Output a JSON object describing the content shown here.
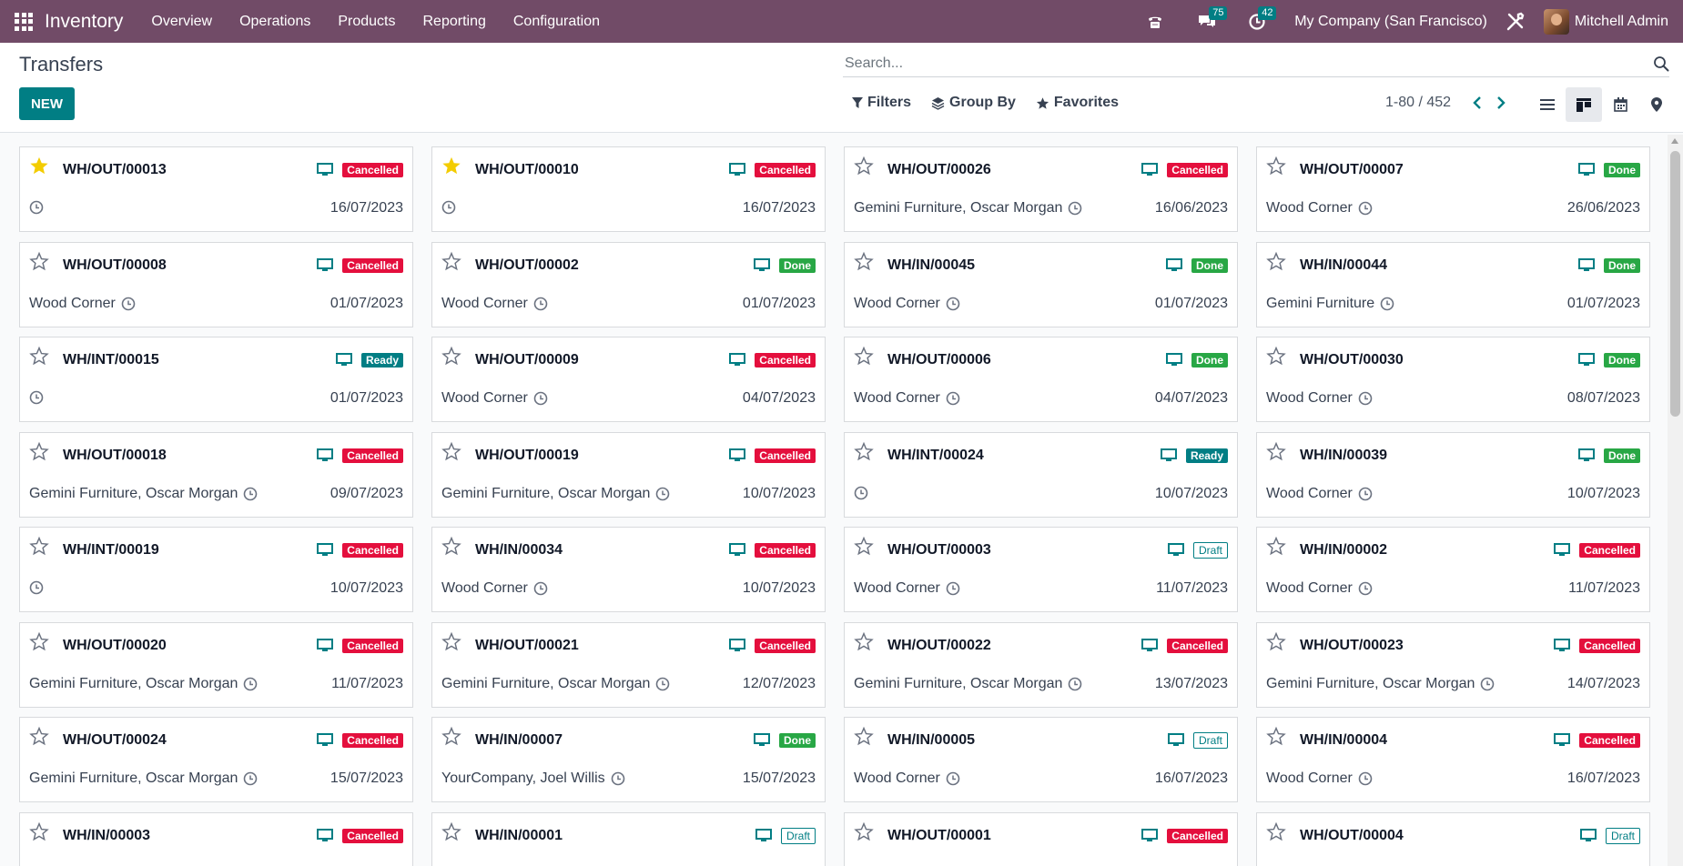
{
  "app": {
    "name": "Inventory",
    "menu": [
      "Overview",
      "Operations",
      "Products",
      "Reporting",
      "Configuration"
    ],
    "messages_badge": "75",
    "activities_badge": "42",
    "company": "My Company (San Francisco)",
    "user": "Mitchell Admin"
  },
  "page": {
    "title": "Transfers",
    "new_button": "NEW",
    "search_placeholder": "Search...",
    "filters": [
      "Filters",
      "Group By",
      "Favorites"
    ],
    "pager": "1-80 / 452"
  },
  "colors": {
    "brand": "#714b67",
    "accent": "#017e84",
    "cancelled": "#e40f3d",
    "done": "#28a745"
  },
  "cards": [
    {
      "ref": "WH/OUT/00013",
      "partner": "",
      "date": "16/07/2023",
      "state": "Cancelled",
      "starred": true
    },
    {
      "ref": "WH/OUT/00010",
      "partner": "",
      "date": "16/07/2023",
      "state": "Cancelled",
      "starred": true
    },
    {
      "ref": "WH/OUT/00026",
      "partner": "Gemini Furniture, Oscar Morgan",
      "date": "16/06/2023",
      "state": "Cancelled",
      "starred": false
    },
    {
      "ref": "WH/OUT/00007",
      "partner": "Wood Corner",
      "date": "26/06/2023",
      "state": "Done",
      "starred": false
    },
    {
      "ref": "WH/OUT/00008",
      "partner": "Wood Corner",
      "date": "01/07/2023",
      "state": "Cancelled",
      "starred": false
    },
    {
      "ref": "WH/OUT/00002",
      "partner": "Wood Corner",
      "date": "01/07/2023",
      "state": "Done",
      "starred": false
    },
    {
      "ref": "WH/IN/00045",
      "partner": "Wood Corner",
      "date": "01/07/2023",
      "state": "Done",
      "starred": false
    },
    {
      "ref": "WH/IN/00044",
      "partner": "Gemini Furniture",
      "date": "01/07/2023",
      "state": "Done",
      "starred": false
    },
    {
      "ref": "WH/INT/00015",
      "partner": "",
      "date": "01/07/2023",
      "state": "Ready",
      "starred": false
    },
    {
      "ref": "WH/OUT/00009",
      "partner": "Wood Corner",
      "date": "04/07/2023",
      "state": "Cancelled",
      "starred": false
    },
    {
      "ref": "WH/OUT/00006",
      "partner": "Wood Corner",
      "date": "04/07/2023",
      "state": "Done",
      "starred": false
    },
    {
      "ref": "WH/OUT/00030",
      "partner": "Wood Corner",
      "date": "08/07/2023",
      "state": "Done",
      "starred": false
    },
    {
      "ref": "WH/OUT/00018",
      "partner": "Gemini Furniture, Oscar Morgan",
      "date": "09/07/2023",
      "state": "Cancelled",
      "starred": false
    },
    {
      "ref": "WH/OUT/00019",
      "partner": "Gemini Furniture, Oscar Morgan",
      "date": "10/07/2023",
      "state": "Cancelled",
      "starred": false
    },
    {
      "ref": "WH/INT/00024",
      "partner": "",
      "date": "10/07/2023",
      "state": "Ready",
      "starred": false
    },
    {
      "ref": "WH/IN/00039",
      "partner": "Wood Corner",
      "date": "10/07/2023",
      "state": "Done",
      "starred": false
    },
    {
      "ref": "WH/INT/00019",
      "partner": "",
      "date": "10/07/2023",
      "state": "Cancelled",
      "starred": false
    },
    {
      "ref": "WH/IN/00034",
      "partner": "Wood Corner",
      "date": "10/07/2023",
      "state": "Cancelled",
      "starred": false
    },
    {
      "ref": "WH/OUT/00003",
      "partner": "Wood Corner",
      "date": "11/07/2023",
      "state": "Draft",
      "starred": false
    },
    {
      "ref": "WH/IN/00002",
      "partner": "Wood Corner",
      "date": "11/07/2023",
      "state": "Cancelled",
      "starred": false
    },
    {
      "ref": "WH/OUT/00020",
      "partner": "Gemini Furniture, Oscar Morgan",
      "date": "11/07/2023",
      "state": "Cancelled",
      "starred": false
    },
    {
      "ref": "WH/OUT/00021",
      "partner": "Gemini Furniture, Oscar Morgan",
      "date": "12/07/2023",
      "state": "Cancelled",
      "starred": false
    },
    {
      "ref": "WH/OUT/00022",
      "partner": "Gemini Furniture, Oscar Morgan",
      "date": "13/07/2023",
      "state": "Cancelled",
      "starred": false
    },
    {
      "ref": "WH/OUT/00023",
      "partner": "Gemini Furniture, Oscar Morgan",
      "date": "14/07/2023",
      "state": "Cancelled",
      "starred": false
    },
    {
      "ref": "WH/OUT/00024",
      "partner": "Gemini Furniture, Oscar Morgan",
      "date": "15/07/2023",
      "state": "Cancelled",
      "starred": false
    },
    {
      "ref": "WH/IN/00007",
      "partner": "YourCompany, Joel Willis",
      "date": "15/07/2023",
      "state": "Done",
      "starred": false
    },
    {
      "ref": "WH/IN/00005",
      "partner": "Wood Corner",
      "date": "16/07/2023",
      "state": "Draft",
      "starred": false
    },
    {
      "ref": "WH/IN/00004",
      "partner": "Wood Corner",
      "date": "16/07/2023",
      "state": "Cancelled",
      "starred": false
    },
    {
      "ref": "WH/IN/00003",
      "partner": "",
      "date": "",
      "state": "Cancelled",
      "starred": false
    },
    {
      "ref": "WH/IN/00001",
      "partner": "",
      "date": "",
      "state": "Draft",
      "starred": false
    },
    {
      "ref": "WH/OUT/00001",
      "partner": "",
      "date": "",
      "state": "Cancelled",
      "starred": false
    },
    {
      "ref": "WH/OUT/00004",
      "partner": "",
      "date": "",
      "state": "Draft",
      "starred": false
    }
  ]
}
